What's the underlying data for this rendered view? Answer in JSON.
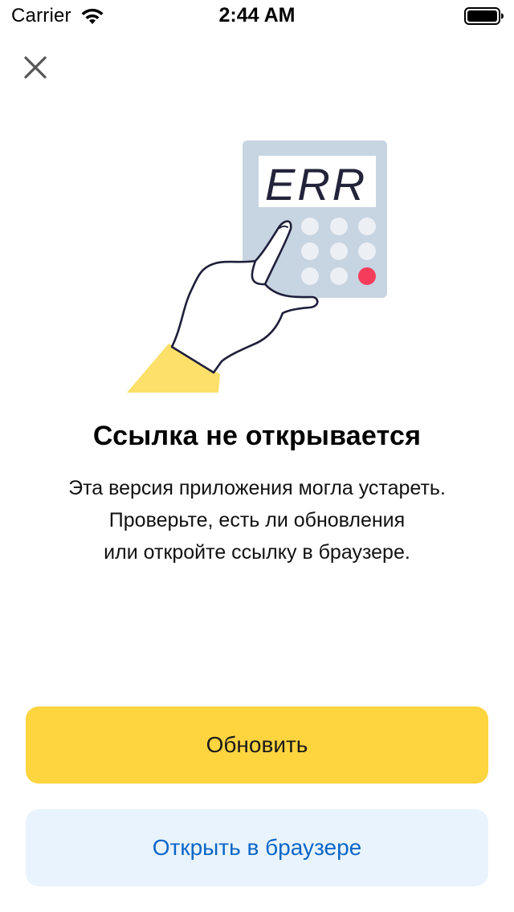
{
  "status_bar": {
    "carrier": "Carrier",
    "time": "2:44 AM",
    "wifi_icon": "wifi-icon",
    "battery_icon": "battery-icon"
  },
  "close": {
    "icon": "close-icon"
  },
  "illustration": {
    "display_text": "ERR",
    "accent_button_color": "#f53d5b",
    "calculator_color": "#c7d4e1",
    "sleeve_color": "#fde06a"
  },
  "content": {
    "title": "Ссылка не открывается",
    "description_lines": [
      "Эта версия приложения могла устареть.",
      "Проверьте, есть ли обновления",
      "или откройте ссылку в браузере."
    ]
  },
  "actions": {
    "update_label": "Обновить",
    "open_browser_label": "Открыть в браузере"
  },
  "colors": {
    "primary_button": "#fed43f",
    "secondary_button": "#e8f3fd",
    "link_text": "#0a66c8"
  }
}
